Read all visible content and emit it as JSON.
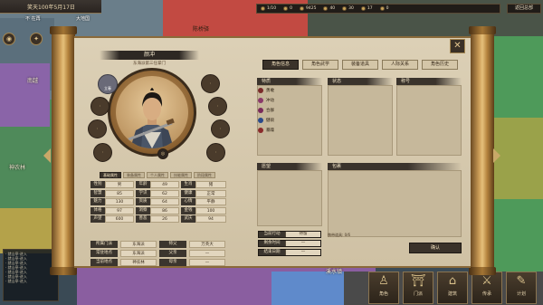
{
  "topbar": {
    "date": "笑天100年5月17日",
    "sub_left": "不 在再",
    "sub_right": "大地国",
    "resources": [
      {
        "icon": "calendar-icon",
        "value": "1/10"
      },
      {
        "icon": "population-icon",
        "value": "0"
      },
      {
        "icon": "coin-icon",
        "value": "9425"
      },
      {
        "icon": "grain-icon",
        "value": "40"
      },
      {
        "icon": "wood-icon",
        "value": "30"
      },
      {
        "icon": "iron-icon",
        "value": "17"
      },
      {
        "icon": "gem-icon",
        "value": "0"
      }
    ],
    "exit_label": "返回总部"
  },
  "map_labels": {
    "top": "陈桥驿",
    "left1": "南越",
    "left2": "神农林",
    "bottom": "溪水镇"
  },
  "log_lines": [
    "· 就山亭·进入",
    "· 就山亭·进入",
    "· 就山亭·进入",
    "· 就山亭·进入",
    "· 就山亭·进入",
    "· 就山亭·进入",
    "· 就山亭·进入"
  ],
  "bottom_buttons": [
    {
      "icon": "character-icon",
      "label": "角色"
    },
    {
      "icon": "gate-icon",
      "label": "门派"
    },
    {
      "icon": "build-icon",
      "label": "建筑"
    },
    {
      "icon": "battle-icon",
      "label": "传承"
    },
    {
      "icon": "plan-icon",
      "label": "计划"
    }
  ],
  "character": {
    "name": "颜冲",
    "title": "东海派第三任掌门",
    "badge": "立春",
    "portrait_icon": "character-portrait"
  },
  "sub_tabs": [
    "基础属性",
    "装备属性",
    "个人属性",
    "技能属性",
    "阶段属性"
  ],
  "stats": [
    [
      [
        "性别",
        "男"
      ],
      [
        "年龄",
        "49"
      ],
      [
        "生肖",
        "猪"
      ]
    ],
    [
      [
        "智慧",
        "85"
      ],
      [
        "学识",
        "62"
      ],
      [
        "健康",
        "正常"
      ]
    ],
    [
      [
        "魅力",
        "130"
      ],
      [
        "资质",
        "64"
      ],
      [
        "心情",
        "平静"
      ]
    ],
    [
      [
        "体格",
        "97"
      ],
      [
        "洞察",
        "86"
      ],
      [
        "金钱",
        "100"
      ]
    ],
    [
      [
        "声望",
        "600"
      ],
      [
        "善恶",
        "26"
      ],
      [
        "武庆",
        "94"
      ]
    ]
  ],
  "info": [
    [
      [
        "所属门派",
        "东海派"
      ],
      [
        "师父",
        "万英大"
      ]
    ],
    [
      [
        "常驻地点",
        "东海派"
      ],
      [
        "父亲",
        "—"
      ]
    ],
    [
      [
        "当前地点",
        "神农林"
      ],
      [
        "母亲",
        "—"
      ]
    ]
  ],
  "activity": [
    [
      "当前行动",
      "待留"
    ],
    [
      "剩余时间",
      "—"
    ],
    [
      "结束日期",
      "—"
    ]
  ],
  "main_tabs": [
    "角色信息",
    "角色武学",
    "装备道具",
    "人际关系",
    "角色历史"
  ],
  "boxes": {
    "traits": "特质",
    "status": "状态",
    "titles": "称号",
    "wishes": "愿望",
    "bag": "包裹"
  },
  "traits": [
    {
      "label": "勇敢",
      "color": "#7a2b2b"
    },
    {
      "label": "冲动",
      "color": "#8a3a6a"
    },
    {
      "label": "合群",
      "color": "#7a2b5a"
    },
    {
      "label": "健硕",
      "color": "#2b4a8a"
    },
    {
      "label": "暴躁",
      "color": "#8a2b2b"
    }
  ],
  "bag_footer": "携带道具: 0/6",
  "confirm_label": "确认"
}
